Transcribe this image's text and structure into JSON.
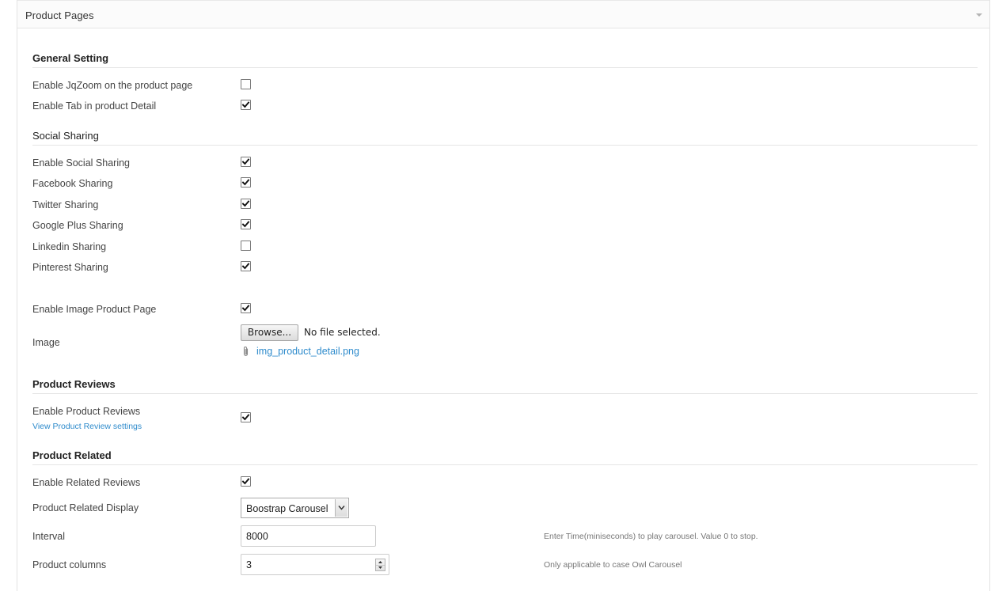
{
  "panel": {
    "title": "Product Pages"
  },
  "general": {
    "title": "General Setting",
    "jqzoom": {
      "label": "Enable JqZoom on the product page",
      "checked": false
    },
    "tab_detail": {
      "label": "Enable Tab in product Detail",
      "checked": true
    }
  },
  "social": {
    "title": "Social Sharing",
    "enable": {
      "label": "Enable Social Sharing",
      "checked": true
    },
    "facebook": {
      "label": "Facebook Sharing",
      "checked": true
    },
    "twitter": {
      "label": "Twitter Sharing",
      "checked": true
    },
    "googleplus": {
      "label": "Google Plus Sharing",
      "checked": true
    },
    "linkedin": {
      "label": "Linkedin Sharing",
      "checked": false
    },
    "pinterest": {
      "label": "Pinterest Sharing",
      "checked": true
    }
  },
  "image_product": {
    "enable": {
      "label": "Enable Image Product Page",
      "checked": true
    },
    "image_label": "Image",
    "browse_label": "Browse...",
    "file_status": "No file selected.",
    "current_file": "img_product_detail.png",
    "attachment_icon": "paperclip-icon"
  },
  "reviews": {
    "title": "Product Reviews",
    "enable": {
      "label": "Enable Product Reviews",
      "checked": true
    },
    "settings_link": "View Product Review settings"
  },
  "related": {
    "title": "Product Related",
    "enable": {
      "label": "Enable Related Reviews",
      "checked": true
    },
    "display": {
      "label": "Product Related Display",
      "value": "Boostrap Carousel"
    },
    "interval": {
      "label": "Interval",
      "value": "8000",
      "help": "Enter Time(miniseconds) to play carousel. Value 0 to stop."
    },
    "columns": {
      "label": "Product columns",
      "value": "3",
      "help": "Only applicable to case Owl Carousel"
    }
  },
  "colors": {
    "link": "#2e8bcc",
    "text": "#444444",
    "help_text": "#777777",
    "rule": "#e5e5e5"
  }
}
